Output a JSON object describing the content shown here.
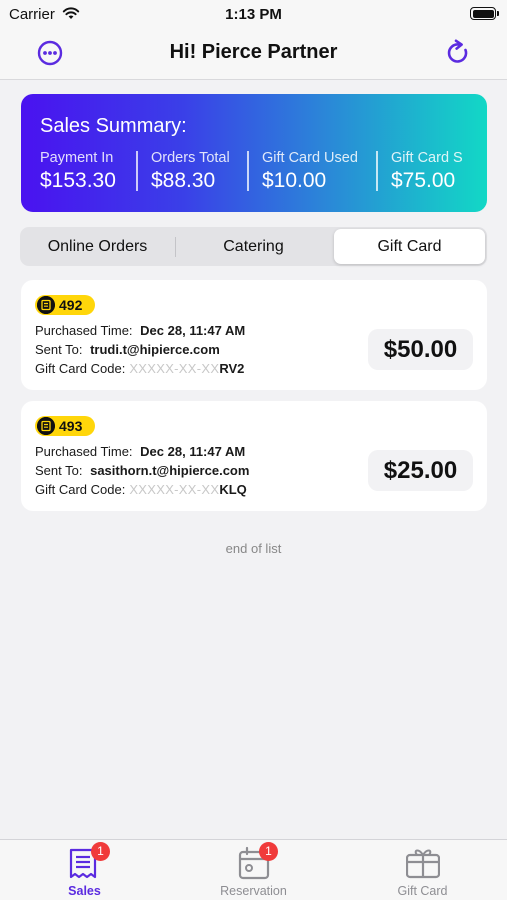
{
  "status_bar": {
    "carrier": "Carrier",
    "time": "1:13 PM"
  },
  "nav": {
    "title": "Hi! Pierce Partner"
  },
  "summary": {
    "title": "Sales Summary:",
    "metrics": [
      {
        "label": "Payment In",
        "value": "$153.30"
      },
      {
        "label": "Orders Total",
        "value": "$88.30"
      },
      {
        "label": "Gift Card Used",
        "value": "$10.00"
      },
      {
        "label": "Gift Card S",
        "value": "$75.00"
      }
    ]
  },
  "segments": {
    "items": [
      {
        "label": "Online Orders"
      },
      {
        "label": "Catering"
      },
      {
        "label": "Gift Card"
      }
    ],
    "selected": "Gift Card"
  },
  "orders": [
    {
      "number": "492",
      "purchased_label": "Purchased Time:",
      "purchased_value": "Dec 28, 11:47 AM",
      "sent_label": "Sent To:",
      "sent_value": "trudi.t@hipierce.com",
      "code_label": "Gift Card Code:",
      "code_mask": "XXXXX-XX-XX",
      "code_tail": "RV2",
      "amount": "$50.00"
    },
    {
      "number": "493",
      "purchased_label": "Purchased Time:",
      "purchased_value": "Dec 28, 11:47 AM",
      "sent_label": "Sent To:",
      "sent_value": "sasithorn.t@hipierce.com",
      "code_label": "Gift Card Code:",
      "code_mask": "XXXXX-XX-XX",
      "code_tail": "KLQ",
      "amount": "$25.00"
    }
  ],
  "end_of_list": "end of list",
  "tab_bar": {
    "tabs": [
      {
        "label": "Sales",
        "icon": "receipt-icon",
        "badge": "1",
        "active": true
      },
      {
        "label": "Reservation",
        "icon": "calendar-icon",
        "badge": "1",
        "active": false
      },
      {
        "label": "Gift Card",
        "icon": "gift-card-icon",
        "badge": "",
        "active": false
      }
    ]
  },
  "colors": {
    "accent": "#5b2be0",
    "gradient_start": "#4a12f0",
    "gradient_end": "#12d8c6",
    "badge_yellow": "#ffd60a",
    "notification_red": "#f03a3a"
  }
}
